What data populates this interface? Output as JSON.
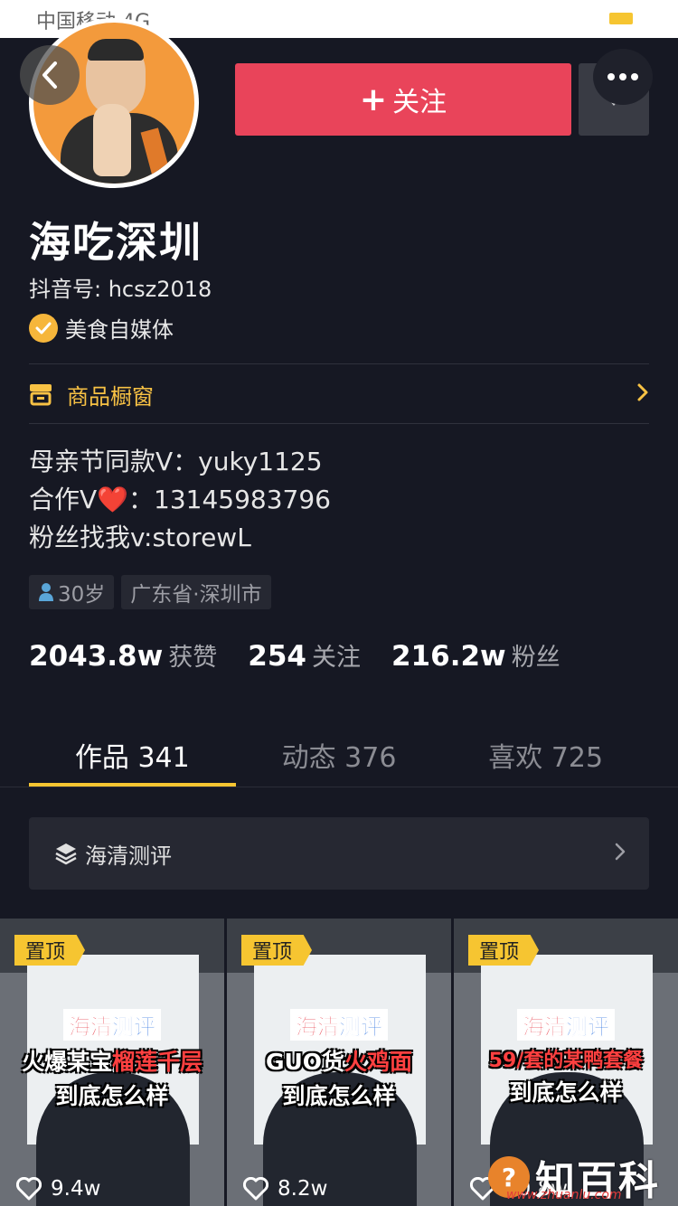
{
  "status_bar": {
    "carrier": "中国移动 4G"
  },
  "header": {
    "follow_label": "关注",
    "follow_plus": "+"
  },
  "profile": {
    "name": "海吃深圳",
    "douyin_id": "抖音号: hcsz2018",
    "verify_label": "美食自媒体",
    "shop_label": "商品橱窗",
    "bio_lines": [
      "母亲节同款V：yuky1125",
      "合作V❤️：13145983796",
      "粉丝找我v:storewL"
    ],
    "tags": {
      "age": "30岁",
      "location": "广东省·深圳市"
    }
  },
  "stats": [
    {
      "num": "2043.8w",
      "label": "获赞"
    },
    {
      "num": "254",
      "label": "关注"
    },
    {
      "num": "216.2w",
      "label": "粉丝"
    }
  ],
  "tabs": [
    {
      "label": "作品 341"
    },
    {
      "label": "动态 376"
    },
    {
      "label": "喜欢 725"
    }
  ],
  "collection": {
    "label": "海清测评"
  },
  "videos": [
    {
      "pin": "置顶",
      "cap1_a": "海清",
      "cap1_b": "测评",
      "cap2_a": "火爆某宝",
      "cap2_b": "榴莲千层",
      "cap3": "到底怎么样",
      "likes": "9.4w"
    },
    {
      "pin": "置顶",
      "cap1_a": "海清",
      "cap1_b": "测评",
      "cap2_a": "GUO货",
      "cap2_b": "火鸡面",
      "cap3": "到底怎么样",
      "likes": "8.2w"
    },
    {
      "pin": "置顶",
      "cap1_a": "海清",
      "cap1_b": "测评",
      "cap2_a": "59/套的某鸭套餐",
      "cap2_b": "",
      "cap3": "到底怎么样",
      "likes": "10.8w"
    }
  ],
  "watermark": {
    "icon": "?",
    "text": "知百科",
    "url": "www.zhuanlu.com"
  },
  "colors": {
    "background": "#161823",
    "follow": "#e9445a",
    "accent": "#f6c531",
    "shop": "#f8c244"
  }
}
